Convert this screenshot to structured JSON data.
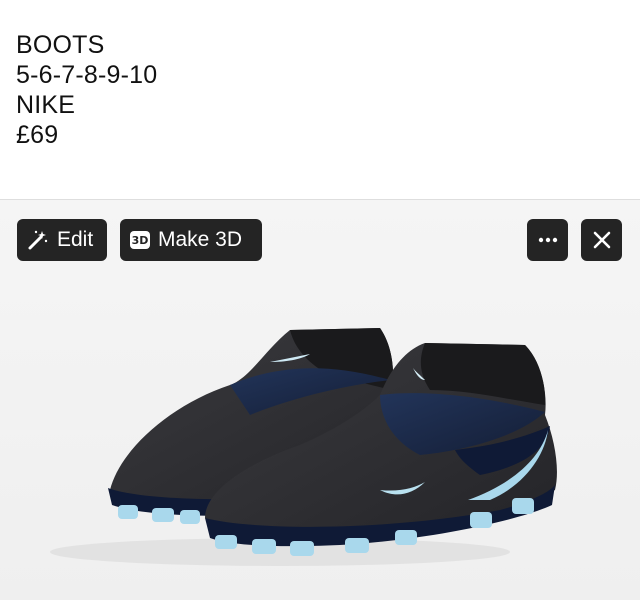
{
  "post": {
    "lines": [
      "BOOTS",
      "5-6-7-8-9-10",
      "NIKE",
      "£69"
    ]
  },
  "toolbar": {
    "edit_label": "Edit",
    "make3d_label": "Make 3D",
    "make3d_badge": "3D"
  },
  "icons": {
    "edit": "magic-wand-icon",
    "make3d": "3d-badge-icon",
    "more": "ellipsis-icon",
    "close": "close-icon"
  },
  "colors": {
    "button_bg": "#242424",
    "boot_dark": "#2a2a2e",
    "boot_navy": "#1c2a4a",
    "accent_blue": "#9fd4ea"
  }
}
